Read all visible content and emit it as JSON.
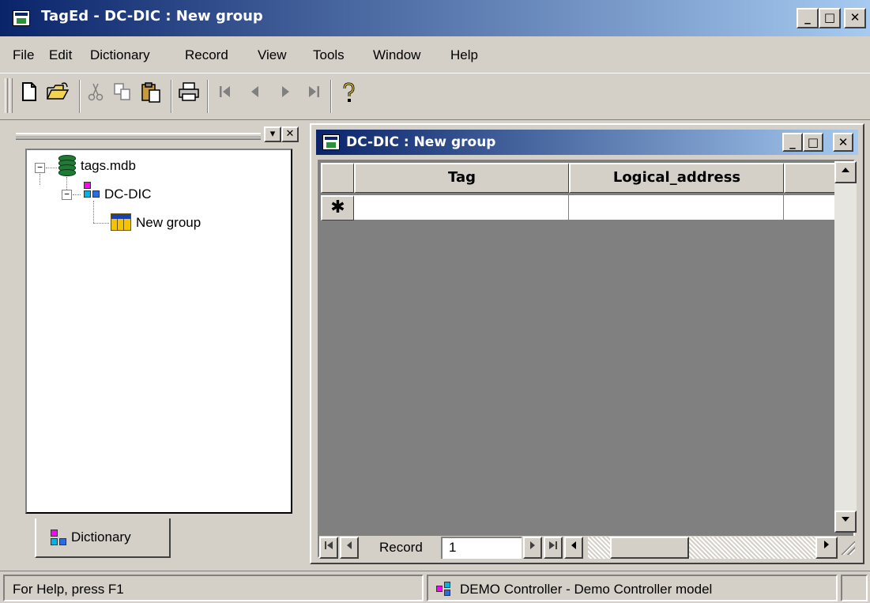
{
  "window": {
    "title": "TagEd - DC-DIC : New group",
    "minimize_label": "_",
    "maximize_label": "□",
    "close_label": "✕"
  },
  "menu": {
    "file": "File",
    "edit": "Edit",
    "dictionary": "Dictionary",
    "record": "Record",
    "view": "View",
    "tools": "Tools",
    "window": "Window",
    "help": "Help"
  },
  "toolbar": {
    "new_icon": "new-document-icon",
    "open_icon": "open-folder-icon",
    "cut_icon": "scissors-icon",
    "copy_icon": "copy-icon",
    "paste_icon": "paste-icon",
    "print_icon": "printer-icon",
    "first_icon": "first-record-icon",
    "prev_icon": "previous-record-icon",
    "next_icon": "next-record-icon",
    "last_icon": "last-record-icon",
    "help_icon": "help-question-icon"
  },
  "tree": {
    "root": {
      "label": "tags.mdb",
      "expander": "−"
    },
    "dictionary": {
      "label": "DC-DIC",
      "expander": "−"
    },
    "group": {
      "label": "New group"
    }
  },
  "dock": {
    "tab_label": "Dictionary",
    "dropdown_label": "▾",
    "close_label": "✕"
  },
  "child": {
    "title": "DC-DIC : New group",
    "minimize_label": "_",
    "maximize_label": "□",
    "close_label": "✕"
  },
  "grid": {
    "columns": [
      "Tag",
      "Logical_address",
      ""
    ],
    "new_row_marker": "✱",
    "rows": []
  },
  "navigator": {
    "record_label": "Record",
    "record_value": "1"
  },
  "status": {
    "help_text": "For Help, press F1",
    "controller_text": "DEMO Controller - Demo Controller model"
  },
  "colors": {
    "titlebar_start": "#0a246a",
    "titlebar_end": "#a6caf0",
    "face": "#d4d0c8",
    "grid_background": "#808080"
  }
}
